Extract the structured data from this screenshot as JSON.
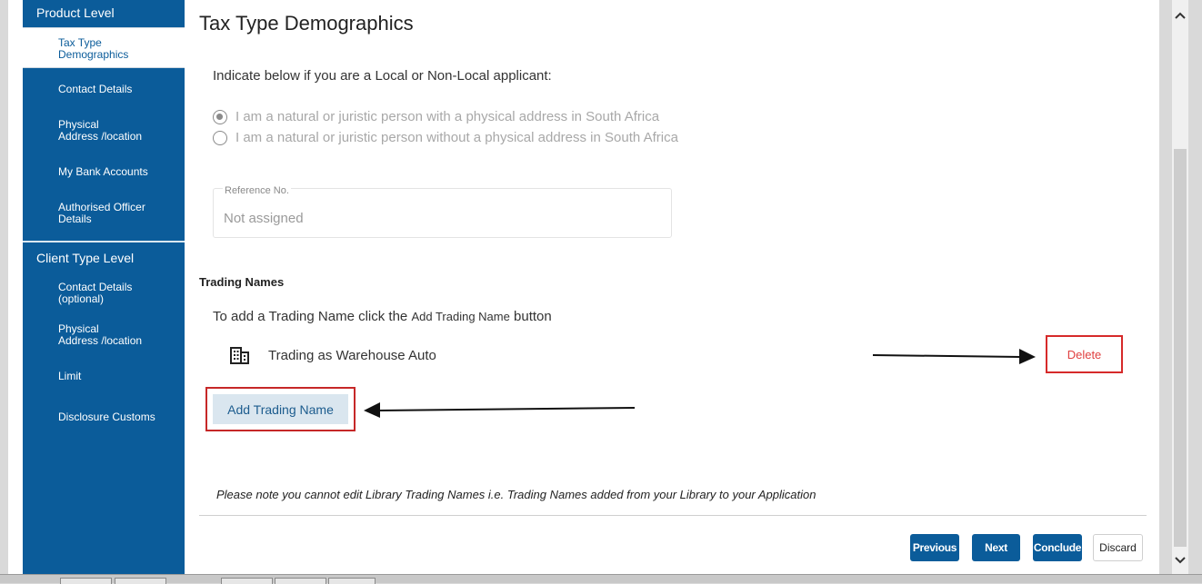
{
  "sidebar": {
    "product_heading": "Product Level",
    "product_items": [
      {
        "label": "Tax Type\nDemographics",
        "active": true
      },
      {
        "label": "Contact Details"
      },
      {
        "label": "Physical\nAddress /location"
      },
      {
        "label": "My Bank Accounts"
      },
      {
        "label": "Authorised Officer\nDetails"
      }
    ],
    "client_heading": "Client Type Level",
    "client_items": [
      {
        "label": "Contact Details\n(optional)"
      },
      {
        "label": "Physical\nAddress /location"
      },
      {
        "label": "Limit"
      },
      {
        "label": "Disclosure Customs"
      }
    ]
  },
  "main": {
    "title": "Tax Type Demographics",
    "intro": "Indicate below if you are a Local or Non-Local applicant:",
    "radio_options": [
      {
        "label": "I am a natural or juristic person with a physical address in South Africa",
        "checked": true
      },
      {
        "label": "I am a natural or juristic person without a physical address in South Africa",
        "checked": false
      }
    ],
    "reference": {
      "label": "Reference No.",
      "value": "Not assigned"
    },
    "trading": {
      "section_title": "Trading Names",
      "instruction_prefix": "To add a Trading Name click the",
      "instruction_button": "Add Trading Name",
      "instruction_suffix": "button",
      "item_name": "Trading as Warehouse Auto",
      "item_icon": "building-icon",
      "delete_label": "Delete",
      "add_label": "Add Trading Name"
    },
    "note": "Please note  you cannot edit Library Trading Names i.e. Trading Names added from your Library to your Application"
  },
  "footer": {
    "previous_label": "Previous",
    "next_label": "Next",
    "conclude_label": "Conclude",
    "discard_label": "Discard"
  },
  "colors": {
    "sidebar_bg": "#0b5c9a",
    "highlight_red": "#d62a2a",
    "add_button_bg": "#dae6ef"
  }
}
